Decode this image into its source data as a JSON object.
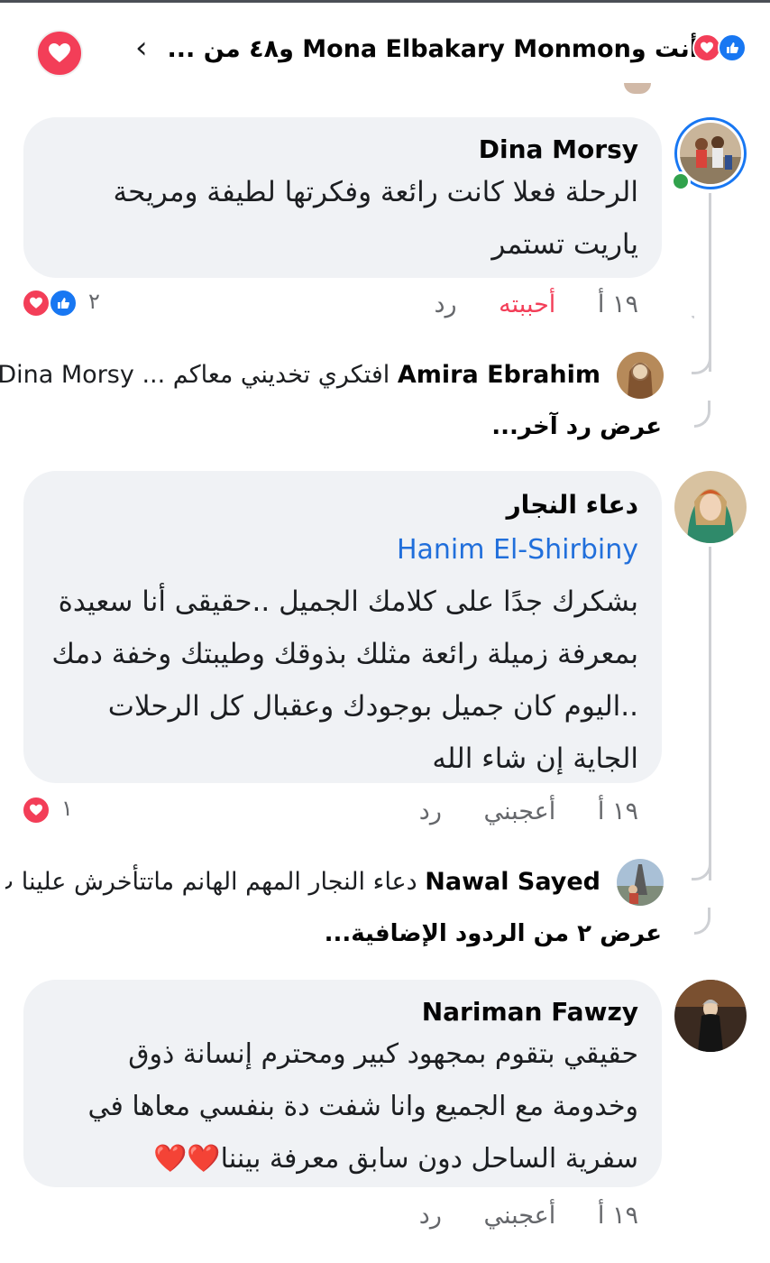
{
  "header": {
    "title": "أنت وMona Elbakary Monmon و٤٨ من ...",
    "back_icon": "chevron-left-icon",
    "action_icon": "heart-icon"
  },
  "colors": {
    "like": "#1877f2",
    "love": "#f33e58",
    "mention": "#216fdb",
    "bubble": "#f0f2f5",
    "online": "#31a24c"
  },
  "comments": [
    {
      "author": "Dina Morsy",
      "text": "الرحلة فعلا كانت رائعة وفكرتها لطيفة ومريحة ياريت تستمر",
      "time": "١٩ أ",
      "like_label": "أحببته",
      "reply_label": "رد",
      "reaction_count": "٢",
      "replies": [
        {
          "author": "Amira Ebrahim",
          "text": "افتكري تخديني معاكم ... Dina Morsy"
        }
      ],
      "more_replies": "عرض رد آخر..."
    },
    {
      "author": "دعاء النجار",
      "mention": "Hanim El-Shirbiny",
      "text": "بشكرك جدًا على كلامك الجميل ..حقيقى أنا سعيدة بمعرفة زميلة رائعة مثلك بذوقك وطيبتك وخفة دمك ..اليوم كان جميل بوجودك وعقبال كل الرحلات الجاية إن شاء الله",
      "time": "١٩ أ",
      "like_label": "أعجبني",
      "reply_label": "رد",
      "reaction_count": "١",
      "replies": [
        {
          "author": "Nawal Sayed",
          "text": "دعاء النجار المهم الهانم ماتتأخرش علينا ت..."
        }
      ],
      "more_replies": "عرض ٢ من الردود الإضافية..."
    },
    {
      "author": "Nariman Fawzy",
      "text": "حقيقي بتقوم بمجهود كبير ومحترم إنسانة ذوق وخدومة مع الجميع وانا شفت دة بنفسي معاها في سفرية الساحل دون سابق معرفة بيننا",
      "emoji": "❤️❤️",
      "time": "١٩ أ",
      "like_label": "أعجبني",
      "reply_label": "رد"
    }
  ]
}
